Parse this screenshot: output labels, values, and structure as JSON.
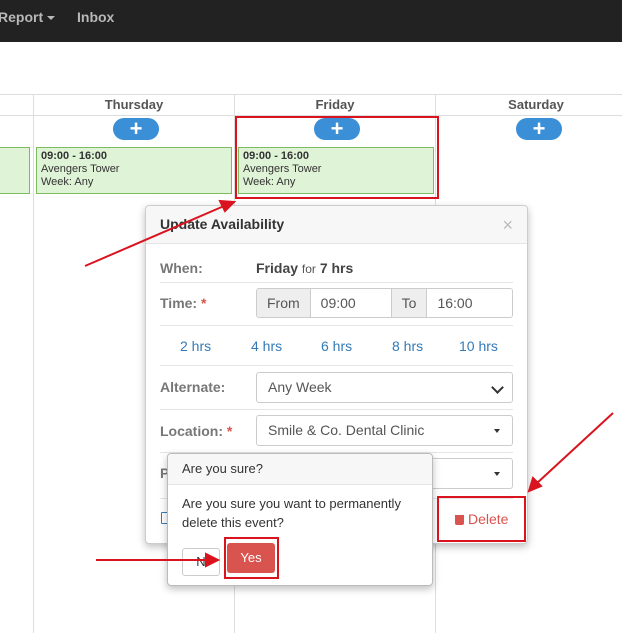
{
  "nav": {
    "report_label": "Report",
    "inbox_label": "Inbox"
  },
  "calendar": {
    "days": [
      "Thursday",
      "Friday",
      "Saturday"
    ],
    "add_symbol": "+",
    "events": [
      {
        "time": "09:00 - 16:00",
        "location": "Avengers Tower",
        "week": "Week: Any"
      },
      {
        "time": "09:00 - 16:00",
        "location": "Avengers Tower",
        "week": "Week: Any"
      }
    ]
  },
  "popover": {
    "title": "Update Availability",
    "close_symbol": "×",
    "when_label": "When:",
    "when_day": "Friday",
    "when_for": "for",
    "when_hours": "7 hrs",
    "time_label": "Time:",
    "required_mark": "*",
    "from_label": "From",
    "from_value": "09:00",
    "to_label": "To",
    "to_value": "16:00",
    "hour_options": [
      "2 hrs",
      "4 hrs",
      "6 hrs",
      "8 hrs",
      "10 hrs"
    ],
    "alternate_label": "Alternate:",
    "alternate_value": "Any Week",
    "location_label": "Location:",
    "location_value": "Smile & Co. Dental Clinic",
    "partial_label": "P",
    "delete_label": "Delete"
  },
  "confirm": {
    "title": "Are you sure?",
    "body": "Are you sure you want to permanently delete this event?",
    "no_label": "N",
    "yes_label": "Yes"
  },
  "colors": {
    "highlight": "#d9141f",
    "danger": "#d9534f",
    "primary": "#3a8fd6",
    "event_bg": "#dff3d6"
  }
}
